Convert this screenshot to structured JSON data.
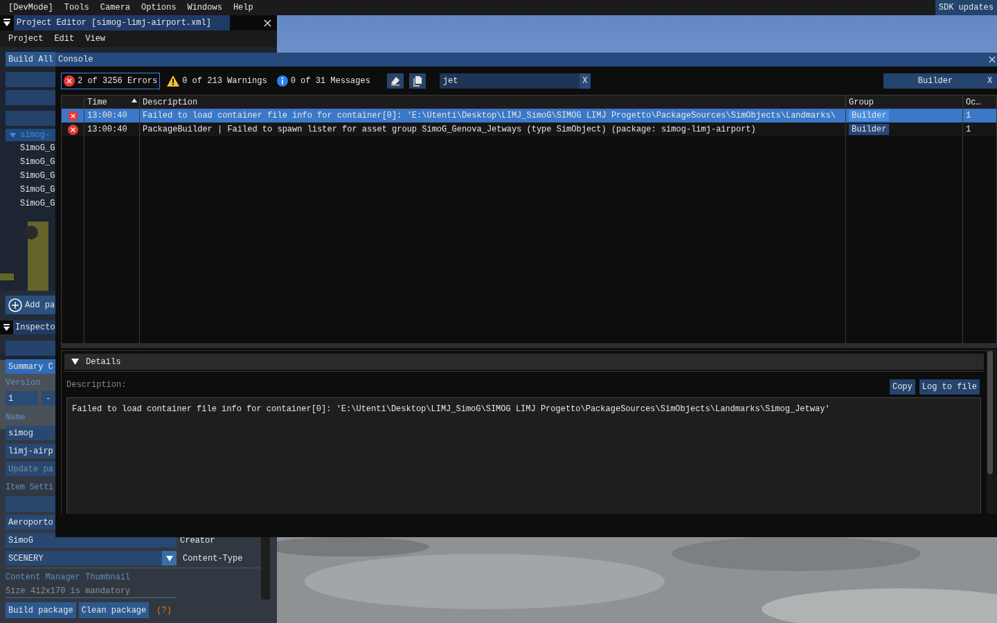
{
  "menu_bar": {
    "items": [
      "[DevMode]",
      "Tools",
      "Camera",
      "Options",
      "Windows",
      "Help"
    ],
    "sdk_button": "SDK updates"
  },
  "project_editor": {
    "title": "Project Editor [simog-limj-airport.xml]",
    "menu": [
      "Project",
      "Edit",
      "View"
    ],
    "build_all": "Build All",
    "tree": [
      {
        "label": "simog-",
        "expanded": true,
        "selected": true,
        "children": [
          {
            "label": "SimoG_G"
          },
          {
            "label": "SimoG_G"
          },
          {
            "label": "SimoG_G"
          },
          {
            "label": "SimoG_G"
          },
          {
            "label": "SimoG_G"
          }
        ]
      }
    ],
    "add_button": "Add pa",
    "inspector_tab": "Inspecto",
    "summary_tab": "Summary C",
    "version_label": "Version",
    "version_value": "1",
    "version_minus": "-",
    "name_label": "Name",
    "name_fields": [
      "simog",
      "limj-airp"
    ],
    "update_button": {
      "label": "Update pa",
      "disabled": true
    },
    "item_settings_label": "Item Setti",
    "fields": [
      {
        "kind": "text",
        "value": "Aeroporto"
      },
      {
        "kind": "text",
        "value": "SimoG",
        "label": "Creator"
      },
      {
        "kind": "dropdown",
        "value": "SCENERY",
        "label": "Content-Type"
      }
    ],
    "thumbnail_label": "Content Manager Thumbnail",
    "thumbnail_note": "Size 412x170 is mandatory",
    "buttons": [
      "Build package",
      "Clean package"
    ],
    "help": "(?)"
  },
  "console": {
    "title": "Console",
    "filters": [
      {
        "kind": "error",
        "label": "2 of 3256 Errors",
        "selected": true
      },
      {
        "kind": "warning",
        "label": "0 of 213 Warnings",
        "selected": false
      },
      {
        "kind": "info",
        "label": "0 of 31 Messages",
        "selected": false
      }
    ],
    "search": {
      "value": "jet",
      "clear": "X"
    },
    "group_filter": {
      "value": "Builder",
      "clear": "X"
    },
    "table": {
      "columns": [
        "Time",
        "Description",
        "Group",
        "Oc…"
      ],
      "rows": [
        {
          "kind": "error",
          "time": "13:00:40",
          "description": "Failed to load container file info for container[0]: 'E:\\Utenti\\Desktop\\LIMJ_SimoG\\SIMOG LIMJ Progetto\\PackageSources\\SimObjects\\Landmarks\\",
          "group": "Builder",
          "count": "1",
          "selected": true
        },
        {
          "kind": "error",
          "time": "13:00:40",
          "description": "PackageBuilder | Failed to spawn lister for asset group SimoG_Genova_Jetways (type SimObject) (package: simog-limj-airport)",
          "group": "Builder",
          "count": "1",
          "selected": false
        }
      ]
    },
    "details": {
      "title": "Details",
      "expanded": true,
      "label": "Description:",
      "buttons": [
        "Copy",
        "Log to file"
      ],
      "text": "Failed to load container file info for container[0]: 'E:\\Utenti\\Desktop\\LIMJ_SimoG\\SIMOG LIMJ Progetto\\PackageSources\\SimObjects\\Landmarks\\Simog_Jetway'"
    }
  }
}
